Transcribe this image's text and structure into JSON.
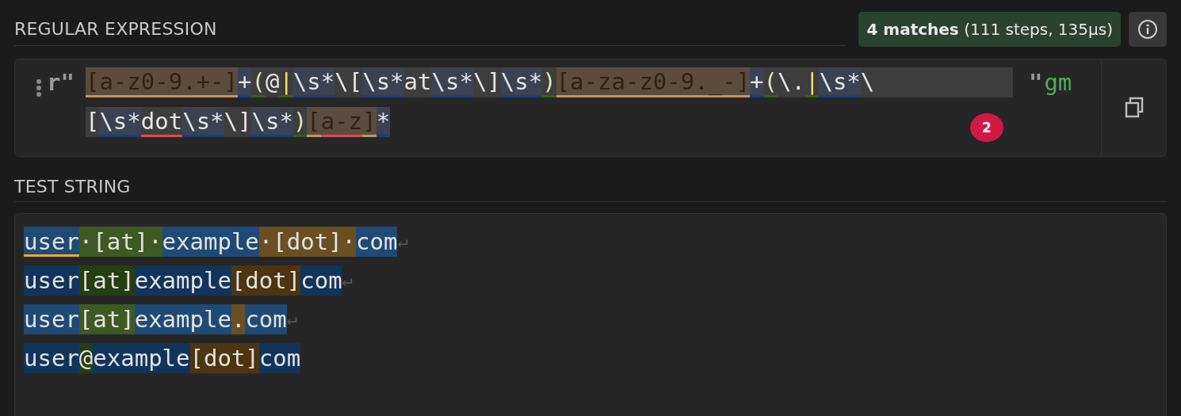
{
  "regex_section": {
    "title": "REGULAR EXPRESSION",
    "match_info": {
      "count": "4 matches",
      "detail": "(111 steps, 135µs)"
    },
    "prefix": "r\"",
    "suffix": "\"",
    "flags": "gm",
    "error_count": "2",
    "lines": [
      [
        {
          "text": "[a-z0-9.+-]",
          "kind": "class",
          "marked": false
        },
        {
          "text": "+",
          "kind": "quant",
          "marked": false
        },
        {
          "text": "(",
          "kind": "group",
          "marked": false
        },
        {
          "text": "@",
          "kind": "literal",
          "marked": false
        },
        {
          "text": "|",
          "kind": "alt",
          "marked": false
        },
        {
          "text": "\\s",
          "kind": "escape",
          "marked": false
        },
        {
          "text": "*",
          "kind": "quant",
          "marked": false
        },
        {
          "text": "\\[",
          "kind": "literal",
          "marked": false
        },
        {
          "text": "\\s",
          "kind": "escape",
          "marked": false
        },
        {
          "text": "*",
          "kind": "quant",
          "marked": false
        },
        {
          "text": "at",
          "kind": "literal",
          "marked": false
        },
        {
          "text": "\\s",
          "kind": "escape",
          "marked": false
        },
        {
          "text": "*",
          "kind": "quant",
          "marked": false
        },
        {
          "text": "\\]",
          "kind": "literal",
          "marked": false
        },
        {
          "text": "\\s",
          "kind": "escape",
          "marked": false
        },
        {
          "text": "*",
          "kind": "quant",
          "marked": false
        },
        {
          "text": ")",
          "kind": "group",
          "marked": false
        },
        {
          "text": "[a-za-z0-9._-]",
          "kind": "class",
          "marked": false
        },
        {
          "text": "+",
          "kind": "quant",
          "marked": false
        },
        {
          "text": "(",
          "kind": "group",
          "marked": false
        },
        {
          "text": "\\.",
          "kind": "literal",
          "marked": false
        },
        {
          "text": "|",
          "kind": "alt",
          "marked": false
        },
        {
          "text": "\\s",
          "kind": "escape",
          "marked": false
        },
        {
          "text": "*",
          "kind": "quant",
          "marked": false
        },
        {
          "text": "\\",
          "kind": "literal",
          "marked": false
        }
      ],
      [
        {
          "text": "[",
          "kind": "literal",
          "marked": false
        },
        {
          "text": "\\s",
          "kind": "escape",
          "marked": false
        },
        {
          "text": "*",
          "kind": "quant",
          "marked": false
        },
        {
          "text": "dot",
          "kind": "literal",
          "marked": true
        },
        {
          "text": "\\s",
          "kind": "escape",
          "marked": false
        },
        {
          "text": "*",
          "kind": "quant",
          "marked": false
        },
        {
          "text": "\\]",
          "kind": "literal",
          "marked": false
        },
        {
          "text": "\\s",
          "kind": "escape",
          "marked": false
        },
        {
          "text": "*",
          "kind": "quant",
          "marked": false
        },
        {
          "text": ")",
          "kind": "group",
          "marked": false
        },
        {
          "text": "[",
          "kind": "class",
          "marked": false
        },
        {
          "text": "a-z",
          "kind": "class",
          "marked": true
        },
        {
          "text": "]",
          "kind": "class",
          "marked": false
        },
        {
          "text": "*",
          "kind": "quant",
          "marked": false
        }
      ]
    ]
  },
  "test_section": {
    "title": "TEST STRING",
    "lines": [
      {
        "alternate": false,
        "eol": "↵",
        "segments": [
          {
            "text": "user",
            "kind": "user",
            "underlined": true
          },
          {
            "text": "·[at]·",
            "kind": "at",
            "underlined": false
          },
          {
            "text": "example",
            "kind": "domain",
            "underlined": false
          },
          {
            "text": "·[dot]·",
            "kind": "dot",
            "underlined": false
          },
          {
            "text": "com",
            "kind": "tld",
            "underlined": false
          }
        ]
      },
      {
        "alternate": true,
        "eol": "↵",
        "segments": [
          {
            "text": "user",
            "kind": "user",
            "underlined": false
          },
          {
            "text": "[at]",
            "kind": "at",
            "underlined": false
          },
          {
            "text": "example",
            "kind": "domain",
            "underlined": false
          },
          {
            "text": "[dot]",
            "kind": "dot",
            "underlined": false
          },
          {
            "text": "com",
            "kind": "tld",
            "underlined": false
          }
        ]
      },
      {
        "alternate": false,
        "eol": "↵",
        "segments": [
          {
            "text": "user",
            "kind": "user",
            "underlined": false
          },
          {
            "text": "[at]",
            "kind": "at",
            "underlined": false
          },
          {
            "text": "example",
            "kind": "domain",
            "underlined": false
          },
          {
            "text": ".",
            "kind": "dot",
            "underlined": false
          },
          {
            "text": "com",
            "kind": "tld",
            "underlined": false
          }
        ]
      },
      {
        "alternate": true,
        "segments": [
          {
            "text": "user",
            "kind": "user",
            "underlined": false
          },
          {
            "text": "@",
            "kind": "at",
            "underlined": false
          },
          {
            "text": "example",
            "kind": "domain",
            "underlined": false
          },
          {
            "text": "[dot]",
            "kind": "dot",
            "underlined": false
          },
          {
            "text": "com",
            "kind": "tld",
            "underlined": false
          }
        ]
      }
    ]
  }
}
